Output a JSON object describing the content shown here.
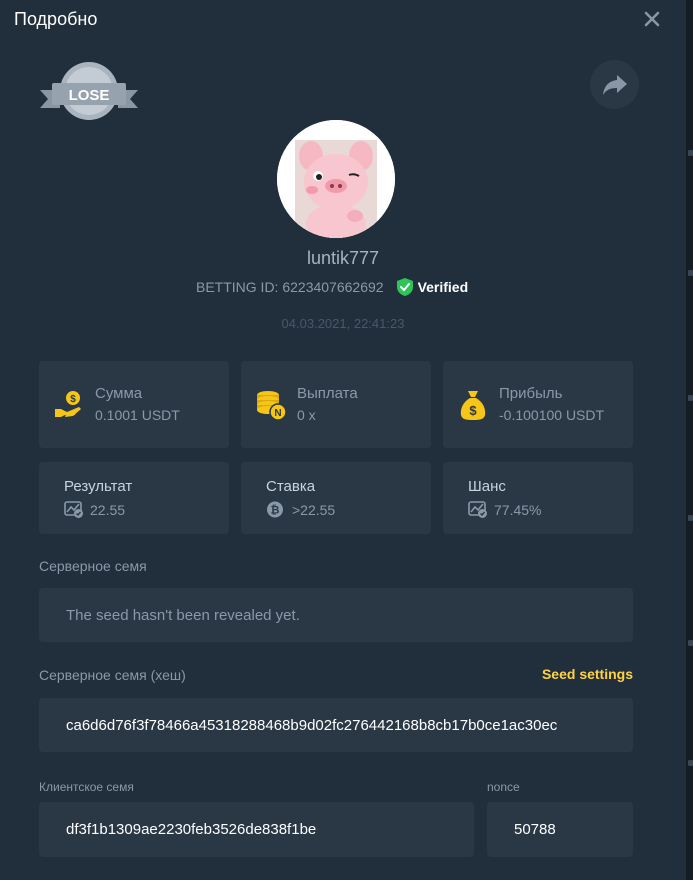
{
  "header": {
    "title": "Подробно"
  },
  "badge": {
    "label": "LOSE"
  },
  "user": {
    "username": "luntik777",
    "betting_id_label": "BETTING ID: 6223407662692",
    "verified_label": "Verified",
    "date": "04.03.2021, 22:41:23"
  },
  "stats": [
    {
      "icon": "coin-hand-icon",
      "label": "Сумма",
      "value": "0.1001 USDT"
    },
    {
      "icon": "coin-stack-icon",
      "label": "Выплата",
      "value": "0 x"
    },
    {
      "icon": "money-bag-icon",
      "label": "Прибыль",
      "value": "-0.100100 USDT"
    }
  ],
  "results": [
    {
      "icon": "chart-check-icon",
      "label": "Результат",
      "value": "22.55"
    },
    {
      "icon": "bitcoin-icon",
      "label": "Ставка",
      "value": ">22.55"
    },
    {
      "icon": "chart-check-icon",
      "label": "Шанс",
      "value": "77.45%"
    }
  ],
  "server_seed": {
    "label": "Серверное семя",
    "value": "The seed hasn't been revealed yet."
  },
  "server_seed_hash": {
    "label": "Серверное семя (хеш)",
    "link": "Seed settings",
    "value": "ca6d6d76f3f78466a45318288468b9d02fc276442168b8cb17b0ce1ac30ec"
  },
  "client_seed": {
    "label": "Клиентское семя",
    "value": "df3f1b1309ae2230feb3526de838f1be"
  },
  "nonce": {
    "label": "nonce",
    "value": "50788"
  },
  "colors": {
    "background": "#212e3b",
    "card": "#2a3846",
    "accent": "#ffd33f",
    "verified": "#2fc35a"
  }
}
